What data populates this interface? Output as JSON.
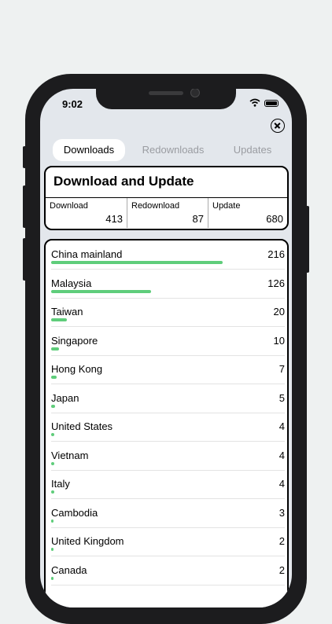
{
  "status_bar": {
    "time": "9:02"
  },
  "tabs": [
    {
      "label": "Downloads",
      "active": true
    },
    {
      "label": "Redownloads",
      "active": false
    },
    {
      "label": "Updates",
      "active": false
    }
  ],
  "summary": {
    "title": "Download and Update",
    "stats": [
      {
        "label": "Download",
        "value": "413"
      },
      {
        "label": "Redownload",
        "value": "87"
      },
      {
        "label": "Update",
        "value": "680"
      }
    ]
  },
  "countries": [
    {
      "name": "China mainland",
      "count": 216
    },
    {
      "name": "Malaysia",
      "count": 126
    },
    {
      "name": "Taiwan",
      "count": 20
    },
    {
      "name": "Singapore",
      "count": 10
    },
    {
      "name": "Hong Kong",
      "count": 7
    },
    {
      "name": "Japan",
      "count": 5
    },
    {
      "name": "United States",
      "count": 4
    },
    {
      "name": "Vietnam",
      "count": 4
    },
    {
      "name": "Italy",
      "count": 4
    },
    {
      "name": "Cambodia",
      "count": 3
    },
    {
      "name": "United Kingdom",
      "count": 2
    },
    {
      "name": "Canada",
      "count": 2
    }
  ],
  "colors": {
    "bar": "#5fcd7b",
    "background": "#e3e7ec"
  },
  "icons": {
    "close": "close-circle-icon",
    "wifi": "wifi-icon",
    "battery": "battery-icon"
  }
}
